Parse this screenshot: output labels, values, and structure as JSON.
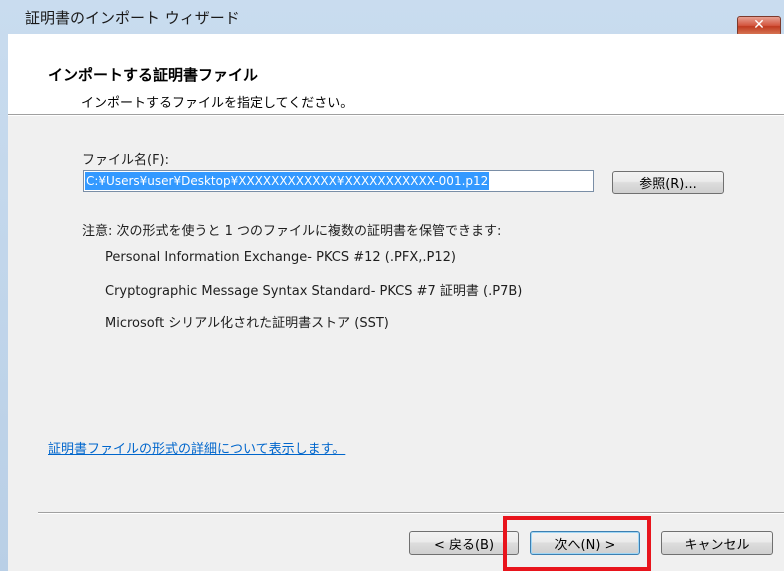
{
  "window": {
    "title": "証明書のインポート ウィザード",
    "close_label": "✕"
  },
  "header": {
    "title": "インポートする証明書ファイル",
    "subtitle": "インポートするファイルを指定してください。"
  },
  "file": {
    "label": "ファイル名(F):",
    "value": "C:¥Users¥user¥Desktop¥XXXXXXXXXXXX¥XXXXXXXXXXX-001.p12",
    "browse_label": "参照(R)..."
  },
  "note": "注意: 次の形式を使うと 1 つのファイルに複数の証明書を保管できます:",
  "formats": [
    "Personal Information Exchange- PKCS #12 (.PFX,.P12)",
    "Cryptographic Message Syntax Standard- PKCS #7 証明書 (.P7B)",
    "Microsoft シリアル化された証明書ストア (SST)"
  ],
  "link": "証明書ファイルの形式の詳細について表示します。",
  "buttons": {
    "back": "< 戻る(B)",
    "next": "次へ(N) >",
    "cancel": "キャンセル"
  },
  "colors": {
    "highlight": "#e8141c",
    "link": "#0066cc",
    "selection": "#3399ff"
  }
}
